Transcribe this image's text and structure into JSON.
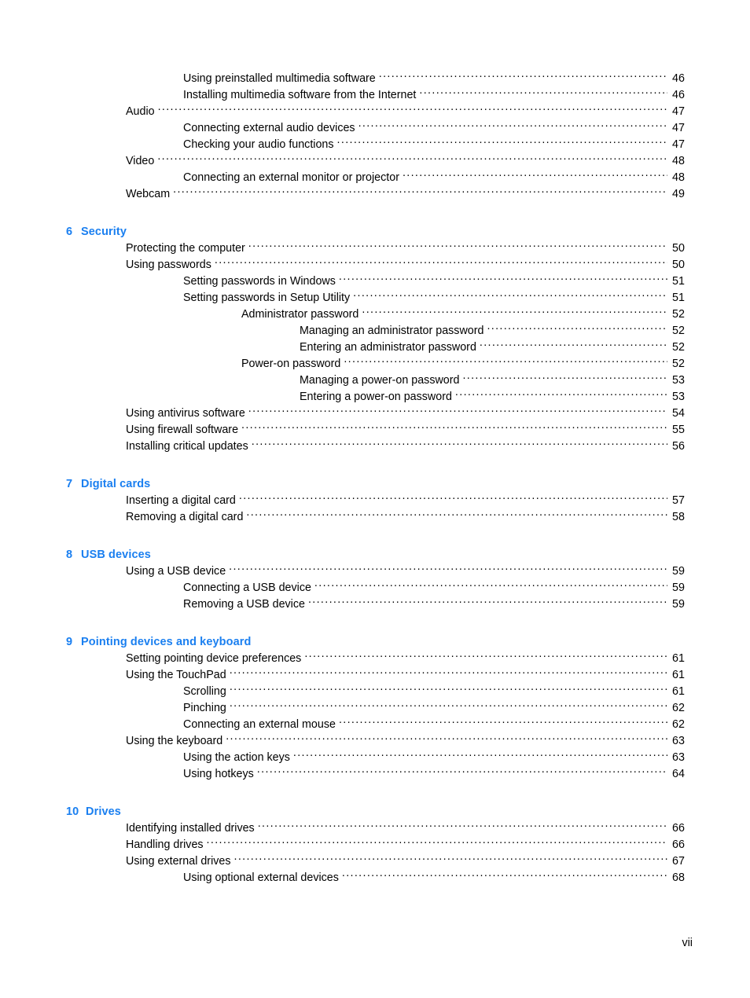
{
  "page": {
    "folio": "vii",
    "heading_color": "#1a7ff0",
    "text_color": "#000000",
    "background_color": "#ffffff"
  },
  "toc": {
    "blocks": [
      {
        "type": "entries",
        "entries": [
          {
            "label": "Using preinstalled multimedia software",
            "page": "46",
            "level": 2
          },
          {
            "label": "Installing multimedia software from the Internet",
            "page": "46",
            "level": 2
          },
          {
            "label": "Audio",
            "page": "47",
            "level": 1
          },
          {
            "label": "Connecting external audio devices",
            "page": "47",
            "level": 2
          },
          {
            "label": "Checking your audio functions",
            "page": "47",
            "level": 2
          },
          {
            "label": "Video",
            "page": "48",
            "level": 1
          },
          {
            "label": "Connecting an external monitor or projector",
            "page": "48",
            "level": 2
          },
          {
            "label": "Webcam",
            "page": "49",
            "level": 1
          }
        ]
      },
      {
        "type": "chapter",
        "number": "6",
        "title": "Security",
        "entries": [
          {
            "label": "Protecting the computer",
            "page": "50",
            "level": 1
          },
          {
            "label": "Using passwords",
            "page": "50",
            "level": 1
          },
          {
            "label": "Setting passwords in Windows",
            "page": "51",
            "level": 2
          },
          {
            "label": "Setting passwords in Setup Utility",
            "page": "51",
            "level": 2
          },
          {
            "label": "Administrator password",
            "page": "52",
            "level": 3
          },
          {
            "label": "Managing an administrator password",
            "page": "52",
            "level": 4
          },
          {
            "label": "Entering an administrator password",
            "page": "52",
            "level": 4
          },
          {
            "label": "Power-on password",
            "page": "52",
            "level": 3
          },
          {
            "label": "Managing a power-on password",
            "page": "53",
            "level": 4
          },
          {
            "label": "Entering a power-on password",
            "page": "53",
            "level": 4
          },
          {
            "label": "Using antivirus software",
            "page": "54",
            "level": 1
          },
          {
            "label": "Using firewall software",
            "page": "55",
            "level": 1
          },
          {
            "label": "Installing critical updates",
            "page": "56",
            "level": 1
          }
        ]
      },
      {
        "type": "chapter",
        "number": "7",
        "title": "Digital cards",
        "entries": [
          {
            "label": "Inserting a digital card",
            "page": "57",
            "level": 1
          },
          {
            "label": "Removing a digital card",
            "page": "58",
            "level": 1
          }
        ]
      },
      {
        "type": "chapter",
        "number": "8",
        "title": "USB devices",
        "entries": [
          {
            "label": "Using a USB device",
            "page": "59",
            "level": 1
          },
          {
            "label": "Connecting a USB device",
            "page": "59",
            "level": 2
          },
          {
            "label": "Removing a USB device",
            "page": "59",
            "level": 2
          }
        ]
      },
      {
        "type": "chapter",
        "number": "9",
        "title": "Pointing devices and keyboard",
        "entries": [
          {
            "label": "Setting pointing device preferences",
            "page": "61",
            "level": 1
          },
          {
            "label": "Using the TouchPad",
            "page": "61",
            "level": 1
          },
          {
            "label": "Scrolling",
            "page": "61",
            "level": 2
          },
          {
            "label": "Pinching",
            "page": "62",
            "level": 2
          },
          {
            "label": "Connecting an external mouse",
            "page": "62",
            "level": 2
          },
          {
            "label": "Using the keyboard",
            "page": "63",
            "level": 1
          },
          {
            "label": "Using the action keys",
            "page": "63",
            "level": 2
          },
          {
            "label": "Using hotkeys",
            "page": "64",
            "level": 2
          }
        ]
      },
      {
        "type": "chapter",
        "number": "10",
        "title": "Drives",
        "entries": [
          {
            "label": "Identifying installed drives",
            "page": "66",
            "level": 1
          },
          {
            "label": "Handling drives",
            "page": "66",
            "level": 1
          },
          {
            "label": "Using external drives",
            "page": "67",
            "level": 1
          },
          {
            "label": "Using optional external devices",
            "page": "68",
            "level": 2
          }
        ]
      }
    ]
  }
}
